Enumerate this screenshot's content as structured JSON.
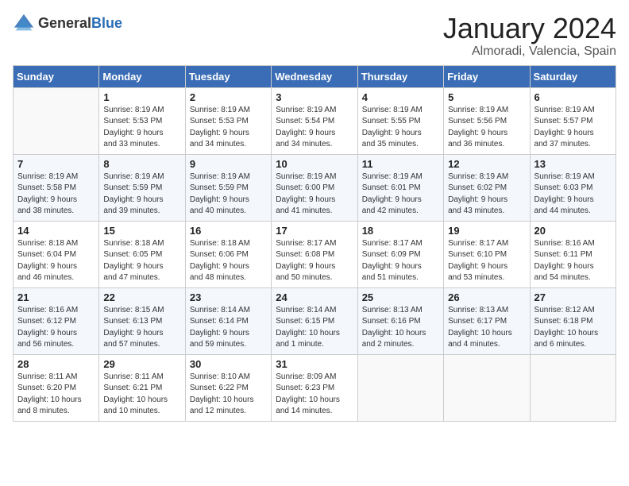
{
  "header": {
    "logo_general": "General",
    "logo_blue": "Blue",
    "month_year": "January 2024",
    "location": "Almoradi, Valencia, Spain"
  },
  "days_of_week": [
    "Sunday",
    "Monday",
    "Tuesday",
    "Wednesday",
    "Thursday",
    "Friday",
    "Saturday"
  ],
  "weeks": [
    [
      {
        "day": "",
        "info": ""
      },
      {
        "day": "1",
        "info": "Sunrise: 8:19 AM\nSunset: 5:53 PM\nDaylight: 9 hours\nand 33 minutes."
      },
      {
        "day": "2",
        "info": "Sunrise: 8:19 AM\nSunset: 5:53 PM\nDaylight: 9 hours\nand 34 minutes."
      },
      {
        "day": "3",
        "info": "Sunrise: 8:19 AM\nSunset: 5:54 PM\nDaylight: 9 hours\nand 34 minutes."
      },
      {
        "day": "4",
        "info": "Sunrise: 8:19 AM\nSunset: 5:55 PM\nDaylight: 9 hours\nand 35 minutes."
      },
      {
        "day": "5",
        "info": "Sunrise: 8:19 AM\nSunset: 5:56 PM\nDaylight: 9 hours\nand 36 minutes."
      },
      {
        "day": "6",
        "info": "Sunrise: 8:19 AM\nSunset: 5:57 PM\nDaylight: 9 hours\nand 37 minutes."
      }
    ],
    [
      {
        "day": "7",
        "info": "Sunrise: 8:19 AM\nSunset: 5:58 PM\nDaylight: 9 hours\nand 38 minutes."
      },
      {
        "day": "8",
        "info": "Sunrise: 8:19 AM\nSunset: 5:59 PM\nDaylight: 9 hours\nand 39 minutes."
      },
      {
        "day": "9",
        "info": "Sunrise: 8:19 AM\nSunset: 5:59 PM\nDaylight: 9 hours\nand 40 minutes."
      },
      {
        "day": "10",
        "info": "Sunrise: 8:19 AM\nSunset: 6:00 PM\nDaylight: 9 hours\nand 41 minutes."
      },
      {
        "day": "11",
        "info": "Sunrise: 8:19 AM\nSunset: 6:01 PM\nDaylight: 9 hours\nand 42 minutes."
      },
      {
        "day": "12",
        "info": "Sunrise: 8:19 AM\nSunset: 6:02 PM\nDaylight: 9 hours\nand 43 minutes."
      },
      {
        "day": "13",
        "info": "Sunrise: 8:19 AM\nSunset: 6:03 PM\nDaylight: 9 hours\nand 44 minutes."
      }
    ],
    [
      {
        "day": "14",
        "info": "Sunrise: 8:18 AM\nSunset: 6:04 PM\nDaylight: 9 hours\nand 46 minutes."
      },
      {
        "day": "15",
        "info": "Sunrise: 8:18 AM\nSunset: 6:05 PM\nDaylight: 9 hours\nand 47 minutes."
      },
      {
        "day": "16",
        "info": "Sunrise: 8:18 AM\nSunset: 6:06 PM\nDaylight: 9 hours\nand 48 minutes."
      },
      {
        "day": "17",
        "info": "Sunrise: 8:17 AM\nSunset: 6:08 PM\nDaylight: 9 hours\nand 50 minutes."
      },
      {
        "day": "18",
        "info": "Sunrise: 8:17 AM\nSunset: 6:09 PM\nDaylight: 9 hours\nand 51 minutes."
      },
      {
        "day": "19",
        "info": "Sunrise: 8:17 AM\nSunset: 6:10 PM\nDaylight: 9 hours\nand 53 minutes."
      },
      {
        "day": "20",
        "info": "Sunrise: 8:16 AM\nSunset: 6:11 PM\nDaylight: 9 hours\nand 54 minutes."
      }
    ],
    [
      {
        "day": "21",
        "info": "Sunrise: 8:16 AM\nSunset: 6:12 PM\nDaylight: 9 hours\nand 56 minutes."
      },
      {
        "day": "22",
        "info": "Sunrise: 8:15 AM\nSunset: 6:13 PM\nDaylight: 9 hours\nand 57 minutes."
      },
      {
        "day": "23",
        "info": "Sunrise: 8:14 AM\nSunset: 6:14 PM\nDaylight: 9 hours\nand 59 minutes."
      },
      {
        "day": "24",
        "info": "Sunrise: 8:14 AM\nSunset: 6:15 PM\nDaylight: 10 hours\nand 1 minute."
      },
      {
        "day": "25",
        "info": "Sunrise: 8:13 AM\nSunset: 6:16 PM\nDaylight: 10 hours\nand 2 minutes."
      },
      {
        "day": "26",
        "info": "Sunrise: 8:13 AM\nSunset: 6:17 PM\nDaylight: 10 hours\nand 4 minutes."
      },
      {
        "day": "27",
        "info": "Sunrise: 8:12 AM\nSunset: 6:18 PM\nDaylight: 10 hours\nand 6 minutes."
      }
    ],
    [
      {
        "day": "28",
        "info": "Sunrise: 8:11 AM\nSunset: 6:20 PM\nDaylight: 10 hours\nand 8 minutes."
      },
      {
        "day": "29",
        "info": "Sunrise: 8:11 AM\nSunset: 6:21 PM\nDaylight: 10 hours\nand 10 minutes."
      },
      {
        "day": "30",
        "info": "Sunrise: 8:10 AM\nSunset: 6:22 PM\nDaylight: 10 hours\nand 12 minutes."
      },
      {
        "day": "31",
        "info": "Sunrise: 8:09 AM\nSunset: 6:23 PM\nDaylight: 10 hours\nand 14 minutes."
      },
      {
        "day": "",
        "info": ""
      },
      {
        "day": "",
        "info": ""
      },
      {
        "day": "",
        "info": ""
      }
    ]
  ]
}
